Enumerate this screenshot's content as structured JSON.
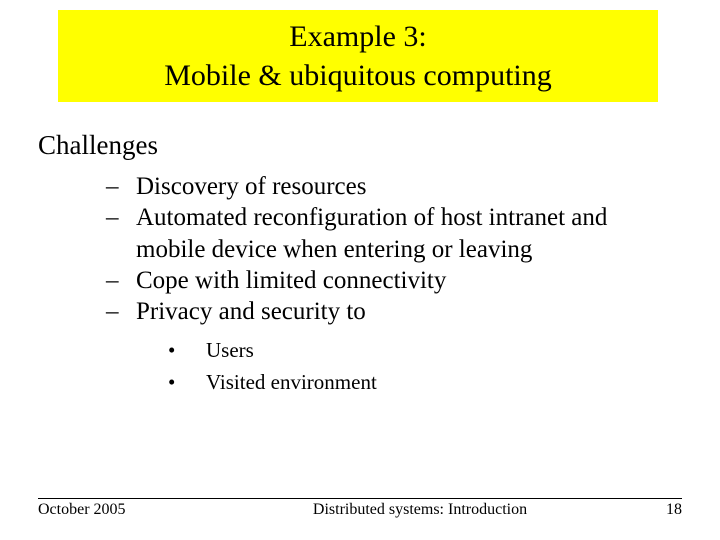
{
  "title": {
    "line1": "Example 3:",
    "line2": "Mobile & ubiquitous computing"
  },
  "heading": "Challenges",
  "bullets": [
    "Discovery of resources",
    "Automated  reconfiguration of host intranet and mobile  device when entering or leaving",
    "Cope with limited connectivity",
    "Privacy and security to"
  ],
  "subbullets": [
    "Users",
    "Visited environment"
  ],
  "footer": {
    "date": "October 2005",
    "title": "Distributed systems: Introduction",
    "page": "18"
  }
}
